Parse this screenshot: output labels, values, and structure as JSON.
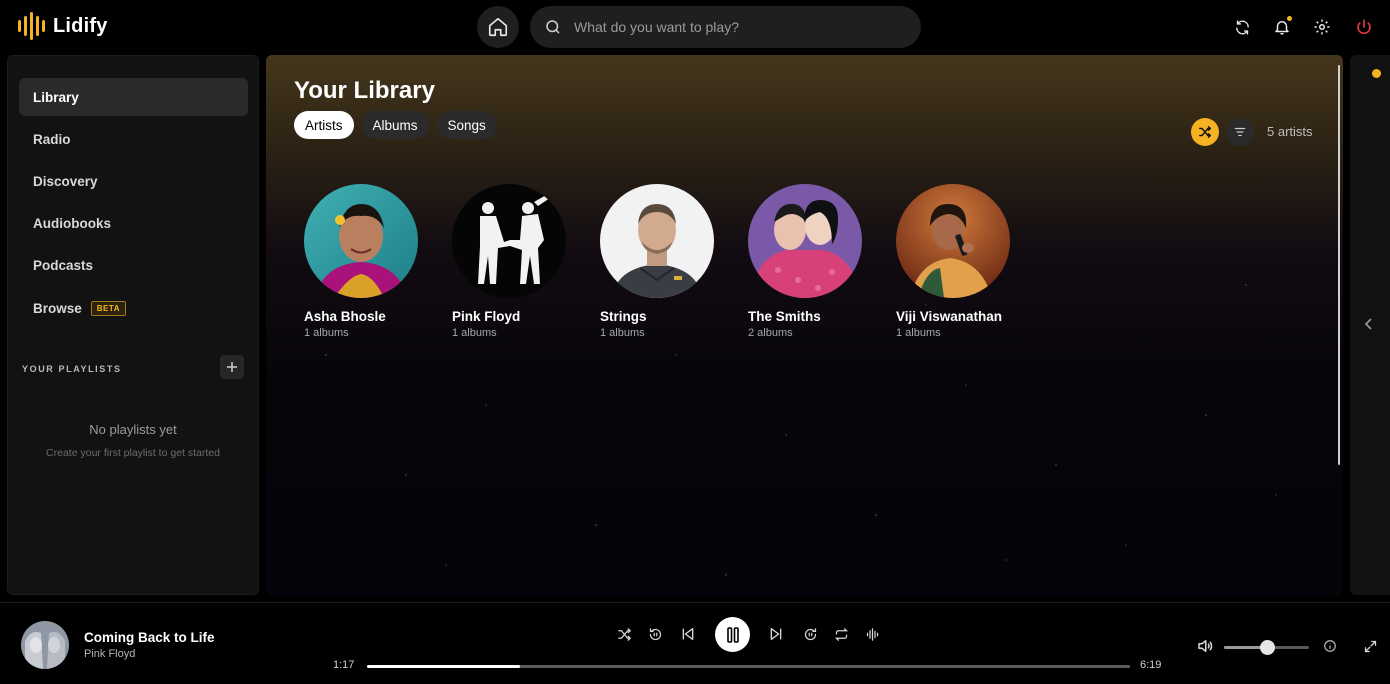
{
  "app": {
    "name": "Lidify",
    "accent_color": "#f5b323"
  },
  "topbar": {
    "search_placeholder": "What do you want to play?",
    "icons": [
      "home-icon",
      "search-icon",
      "refresh-icon",
      "bell-icon",
      "gear-icon",
      "power-icon"
    ]
  },
  "sidebar": {
    "items": [
      {
        "label": "Library",
        "active": true
      },
      {
        "label": "Radio"
      },
      {
        "label": "Discovery"
      },
      {
        "label": "Audiobooks"
      },
      {
        "label": "Podcasts"
      },
      {
        "label": "Browse",
        "badge": "BETA"
      }
    ],
    "playlists_title": "YOUR PLAYLISTS",
    "empty_title": "No playlists yet",
    "empty_subtitle": "Create your first playlist to get started"
  },
  "library": {
    "title": "Your Library",
    "tabs": [
      {
        "label": "Artists",
        "active": true
      },
      {
        "label": "Albums"
      },
      {
        "label": "Songs"
      }
    ],
    "count_label": "5 artists",
    "artists": [
      {
        "name": "Asha Bhosle",
        "subtitle": "1 albums"
      },
      {
        "name": "Pink Floyd",
        "subtitle": "1 albums"
      },
      {
        "name": "Strings",
        "subtitle": "1 albums"
      },
      {
        "name": "The Smiths",
        "subtitle": "2 albums"
      },
      {
        "name": "Viji Viswanathan",
        "subtitle": "1 albums"
      }
    ]
  },
  "player": {
    "track_title": "Coming Back to Life",
    "track_artist": "Pink Floyd",
    "elapsed": "1:17",
    "duration": "6:19",
    "progress_fraction": 0.2,
    "volume_fraction": 0.5
  }
}
